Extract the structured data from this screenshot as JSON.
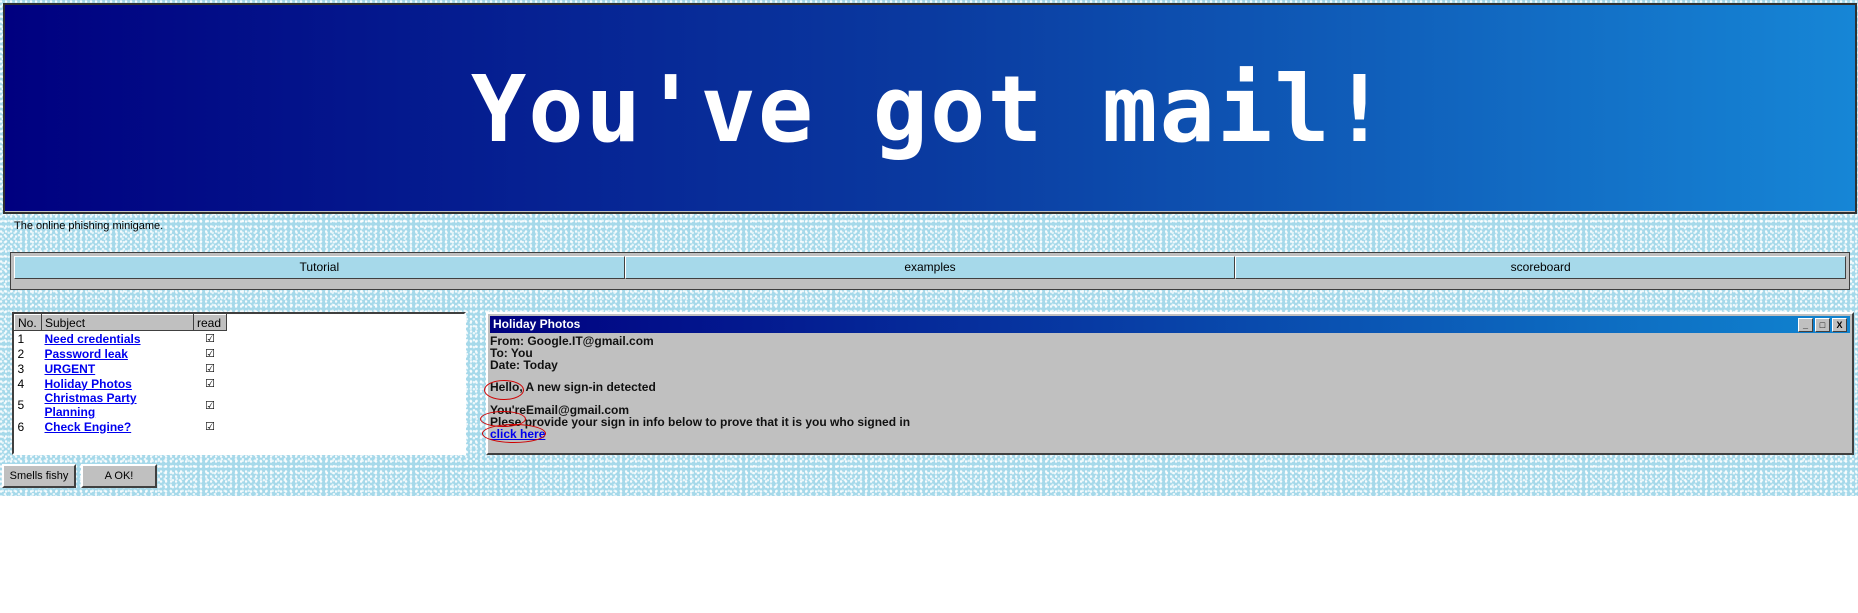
{
  "banner": {
    "title": "You've got mail!",
    "tagline": "The online phishing minigame."
  },
  "nav": {
    "tabs": [
      "Tutorial",
      "examples",
      "scoreboard"
    ]
  },
  "inbox": {
    "headers": {
      "no": "No.",
      "subject": "Subject",
      "read": "read"
    },
    "rows": [
      {
        "no": "1",
        "subject": "Need credentials",
        "read": "☑"
      },
      {
        "no": "2",
        "subject": "Password leak",
        "read": "☑"
      },
      {
        "no": "3",
        "subject": "URGENT",
        "read": "☑"
      },
      {
        "no": "4",
        "subject": "Holiday Photos",
        "read": "☑"
      },
      {
        "no": "5",
        "subject": "Christmas Party Planning",
        "read": "☑"
      },
      {
        "no": "6",
        "subject": "Check Engine?",
        "read": "☑"
      }
    ]
  },
  "actions": {
    "fishy": "Smells fishy",
    "ok": "A OK!"
  },
  "mail": {
    "title": "Holiday Photos",
    "from": "From: Google.IT@gmail.com",
    "to": "To: You",
    "date": "Date: Today",
    "greeting": "Hello, A new sign-in detected",
    "email_line": "You'reEmail@gmail.com",
    "request": "Plese provide your sign in info below to prove that it is you who signed in",
    "link": "click here",
    "window_buttons": [
      "_",
      "□",
      "X"
    ]
  },
  "colors": {
    "banner_start": "#000080",
    "banner_end": "#1686d6",
    "background": "#a6d9ea",
    "highlight": "#d00000"
  }
}
